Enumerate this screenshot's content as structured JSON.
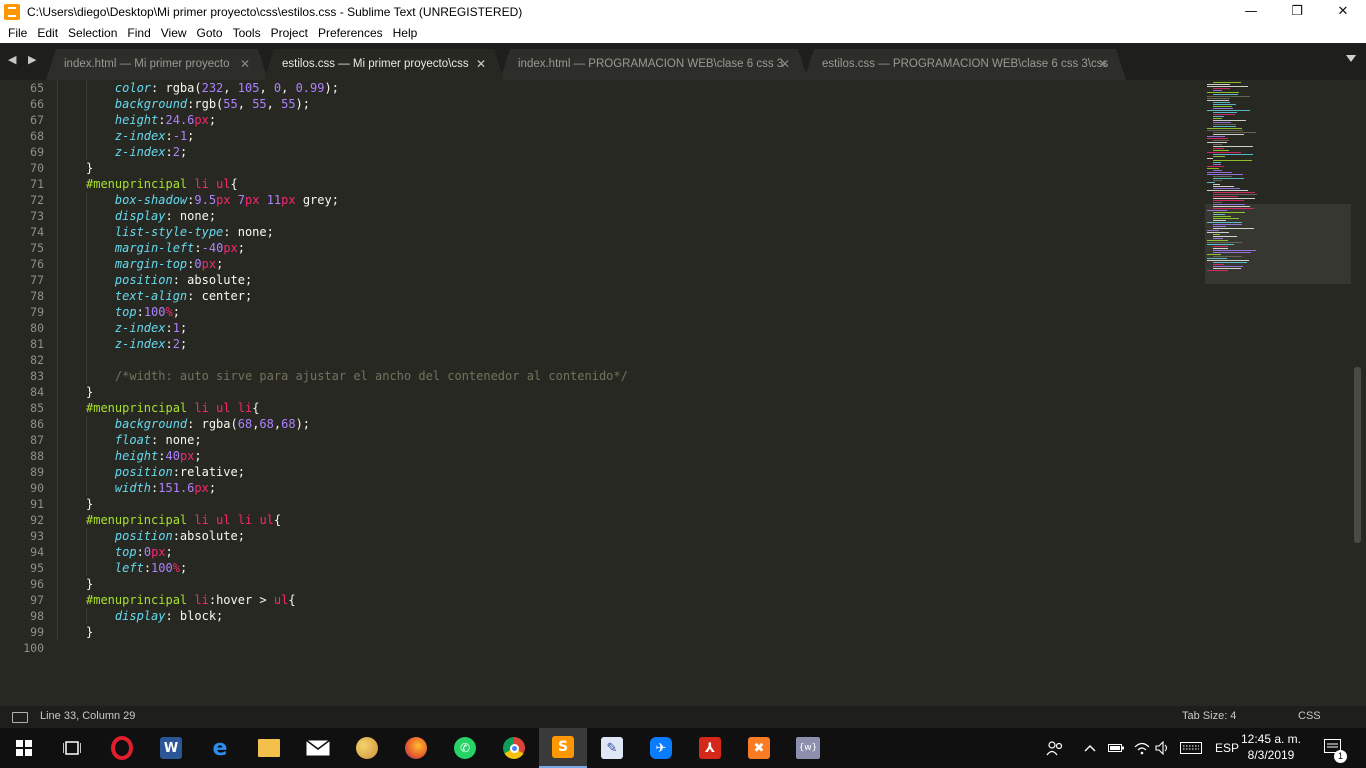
{
  "window": {
    "title": "C:\\Users\\diego\\Desktop\\Mi primer proyecto\\css\\estilos.css - Sublime Text (UNREGISTERED)",
    "minimize": "—",
    "maximize": "❐",
    "close": "✕"
  },
  "menu": [
    "File",
    "Edit",
    "Selection",
    "Find",
    "View",
    "Goto",
    "Tools",
    "Project",
    "Preferences",
    "Help"
  ],
  "tabs": [
    {
      "label": "index.html — Mi primer proyecto",
      "close": "✕"
    },
    {
      "label": "estilos.css — Mi primer proyecto\\css",
      "close": "✕"
    },
    {
      "label": "index.html — PROGRAMACION  WEB\\clase 6 css 3",
      "close": "✕"
    },
    {
      "label": "estilos.css — PROGRAMACION  WEB\\clase 6 css 3\\css",
      "close": "✕"
    }
  ],
  "nav_arrows": "◀ ▶",
  "editor": {
    "lines": [
      65,
      66,
      67,
      68,
      69,
      70,
      71,
      72,
      73,
      74,
      75,
      76,
      77,
      78,
      79,
      80,
      81,
      82,
      83,
      84,
      85,
      86,
      87,
      88,
      89,
      90,
      91,
      92,
      93,
      94,
      95,
      96,
      97,
      98,
      99,
      100
    ]
  },
  "status": {
    "position": "Line 33, Column 29",
    "tab_size": "Tab Size: 4",
    "syntax": "CSS"
  },
  "taskbar": {
    "clock_time": "12:45 a. m.",
    "clock_date": "8/3/2019",
    "language": "ESP",
    "notification_count": "1"
  },
  "colors": {
    "selector": "#a6e22e",
    "tag": "#f92672",
    "property": "#66d9ef",
    "number": "#ae81ff",
    "comment": "#75715e",
    "background": "#272822"
  }
}
